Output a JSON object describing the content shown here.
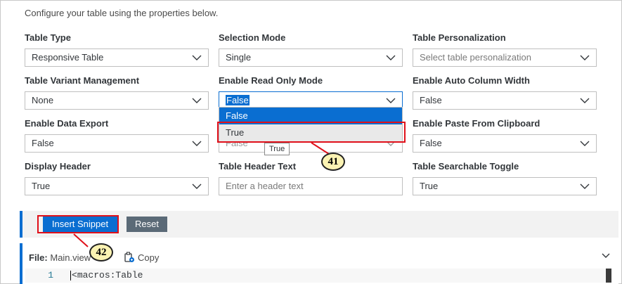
{
  "intro": "Configure your table using the properties below.",
  "fields": {
    "table_type": {
      "label": "Table Type",
      "value": "Responsive Table"
    },
    "selection_mode": {
      "label": "Selection Mode",
      "value": "Single"
    },
    "table_personalization": {
      "label": "Table Personalization",
      "placeholder": "Select table personalization"
    },
    "table_variant_management": {
      "label": "Table Variant Management",
      "value": "None"
    },
    "enable_read_only_mode": {
      "label": "Enable Read Only Mode",
      "value": "False"
    },
    "enable_auto_column_width": {
      "label": "Enable Auto Column Width",
      "value": "False"
    },
    "enable_data_export": {
      "label": "Enable Data Export",
      "value": "False"
    },
    "enable_paste_from_clipboard": {
      "label": "Enable Paste From Clipboard",
      "value": "False"
    },
    "display_header": {
      "label": "Display Header",
      "value": "True"
    },
    "table_header_text": {
      "label": "Table Header Text",
      "placeholder": "Enter a header text"
    },
    "table_searchable_toggle": {
      "label": "Table Searchable Toggle",
      "value": "True"
    }
  },
  "dropdown": {
    "options": [
      "False",
      "True"
    ],
    "tooltip": "True",
    "hidden_value": "False"
  },
  "callouts": {
    "dropdown": "41",
    "insert": "42"
  },
  "toolbar": {
    "insert_label": "Insert Snippet",
    "reset_label": "Reset"
  },
  "code": {
    "file_prefix": "File:",
    "file_name": "Main.view",
    "copy_label": "Copy",
    "line_number": "1",
    "line_text": "macros:Table"
  },
  "colors": {
    "accent": "#0a6ed1",
    "highlight": "#e0101a",
    "callout_fill": "#fbf3b3"
  }
}
